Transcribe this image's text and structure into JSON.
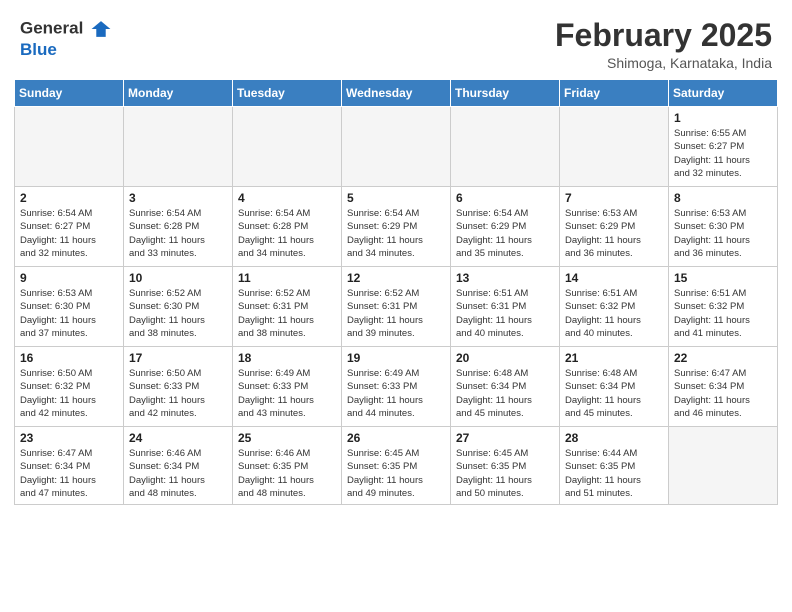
{
  "header": {
    "logo_line1": "General",
    "logo_line2": "Blue",
    "month": "February 2025",
    "location": "Shimoga, Karnataka, India"
  },
  "weekdays": [
    "Sunday",
    "Monday",
    "Tuesday",
    "Wednesday",
    "Thursday",
    "Friday",
    "Saturday"
  ],
  "weeks": [
    [
      {
        "day": "",
        "info": ""
      },
      {
        "day": "",
        "info": ""
      },
      {
        "day": "",
        "info": ""
      },
      {
        "day": "",
        "info": ""
      },
      {
        "day": "",
        "info": ""
      },
      {
        "day": "",
        "info": ""
      },
      {
        "day": "1",
        "info": "Sunrise: 6:55 AM\nSunset: 6:27 PM\nDaylight: 11 hours\nand 32 minutes."
      }
    ],
    [
      {
        "day": "2",
        "info": "Sunrise: 6:54 AM\nSunset: 6:27 PM\nDaylight: 11 hours\nand 32 minutes."
      },
      {
        "day": "3",
        "info": "Sunrise: 6:54 AM\nSunset: 6:28 PM\nDaylight: 11 hours\nand 33 minutes."
      },
      {
        "day": "4",
        "info": "Sunrise: 6:54 AM\nSunset: 6:28 PM\nDaylight: 11 hours\nand 34 minutes."
      },
      {
        "day": "5",
        "info": "Sunrise: 6:54 AM\nSunset: 6:29 PM\nDaylight: 11 hours\nand 34 minutes."
      },
      {
        "day": "6",
        "info": "Sunrise: 6:54 AM\nSunset: 6:29 PM\nDaylight: 11 hours\nand 35 minutes."
      },
      {
        "day": "7",
        "info": "Sunrise: 6:53 AM\nSunset: 6:29 PM\nDaylight: 11 hours\nand 36 minutes."
      },
      {
        "day": "8",
        "info": "Sunrise: 6:53 AM\nSunset: 6:30 PM\nDaylight: 11 hours\nand 36 minutes."
      }
    ],
    [
      {
        "day": "9",
        "info": "Sunrise: 6:53 AM\nSunset: 6:30 PM\nDaylight: 11 hours\nand 37 minutes."
      },
      {
        "day": "10",
        "info": "Sunrise: 6:52 AM\nSunset: 6:30 PM\nDaylight: 11 hours\nand 38 minutes."
      },
      {
        "day": "11",
        "info": "Sunrise: 6:52 AM\nSunset: 6:31 PM\nDaylight: 11 hours\nand 38 minutes."
      },
      {
        "day": "12",
        "info": "Sunrise: 6:52 AM\nSunset: 6:31 PM\nDaylight: 11 hours\nand 39 minutes."
      },
      {
        "day": "13",
        "info": "Sunrise: 6:51 AM\nSunset: 6:31 PM\nDaylight: 11 hours\nand 40 minutes."
      },
      {
        "day": "14",
        "info": "Sunrise: 6:51 AM\nSunset: 6:32 PM\nDaylight: 11 hours\nand 40 minutes."
      },
      {
        "day": "15",
        "info": "Sunrise: 6:51 AM\nSunset: 6:32 PM\nDaylight: 11 hours\nand 41 minutes."
      }
    ],
    [
      {
        "day": "16",
        "info": "Sunrise: 6:50 AM\nSunset: 6:32 PM\nDaylight: 11 hours\nand 42 minutes."
      },
      {
        "day": "17",
        "info": "Sunrise: 6:50 AM\nSunset: 6:33 PM\nDaylight: 11 hours\nand 42 minutes."
      },
      {
        "day": "18",
        "info": "Sunrise: 6:49 AM\nSunset: 6:33 PM\nDaylight: 11 hours\nand 43 minutes."
      },
      {
        "day": "19",
        "info": "Sunrise: 6:49 AM\nSunset: 6:33 PM\nDaylight: 11 hours\nand 44 minutes."
      },
      {
        "day": "20",
        "info": "Sunrise: 6:48 AM\nSunset: 6:34 PM\nDaylight: 11 hours\nand 45 minutes."
      },
      {
        "day": "21",
        "info": "Sunrise: 6:48 AM\nSunset: 6:34 PM\nDaylight: 11 hours\nand 45 minutes."
      },
      {
        "day": "22",
        "info": "Sunrise: 6:47 AM\nSunset: 6:34 PM\nDaylight: 11 hours\nand 46 minutes."
      }
    ],
    [
      {
        "day": "23",
        "info": "Sunrise: 6:47 AM\nSunset: 6:34 PM\nDaylight: 11 hours\nand 47 minutes."
      },
      {
        "day": "24",
        "info": "Sunrise: 6:46 AM\nSunset: 6:34 PM\nDaylight: 11 hours\nand 48 minutes."
      },
      {
        "day": "25",
        "info": "Sunrise: 6:46 AM\nSunset: 6:35 PM\nDaylight: 11 hours\nand 48 minutes."
      },
      {
        "day": "26",
        "info": "Sunrise: 6:45 AM\nSunset: 6:35 PM\nDaylight: 11 hours\nand 49 minutes."
      },
      {
        "day": "27",
        "info": "Sunrise: 6:45 AM\nSunset: 6:35 PM\nDaylight: 11 hours\nand 50 minutes."
      },
      {
        "day": "28",
        "info": "Sunrise: 6:44 AM\nSunset: 6:35 PM\nDaylight: 11 hours\nand 51 minutes."
      },
      {
        "day": "",
        "info": ""
      }
    ]
  ]
}
